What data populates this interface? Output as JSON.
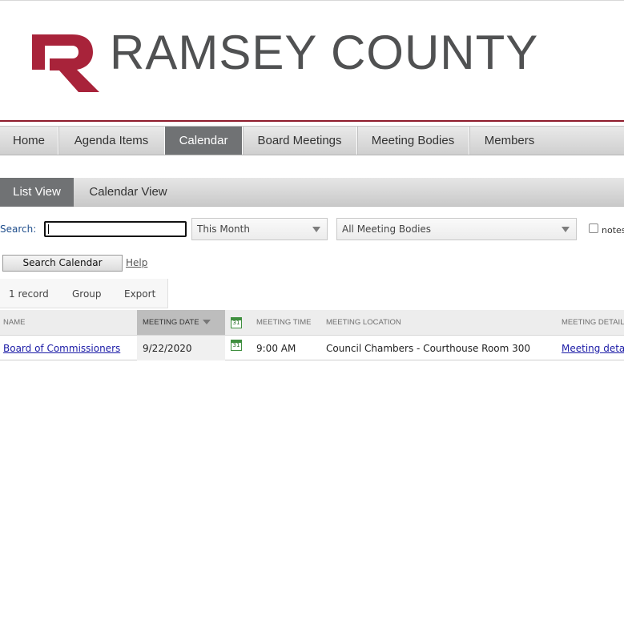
{
  "header": {
    "title": "RAMSEY COUNTY",
    "brand_color": "#a8233a"
  },
  "nav": {
    "items": [
      "Home",
      "Agenda Items",
      "Calendar",
      "Board Meetings",
      "Meeting Bodies",
      "Members"
    ],
    "active": "Calendar"
  },
  "subtabs": {
    "items": [
      "List View",
      "Calendar View"
    ],
    "active": "List View"
  },
  "search": {
    "label": "Search:",
    "value": "",
    "date_filter": "This Month",
    "body_filter": "All Meeting Bodies",
    "notes_label": "notes",
    "notes_checked": false,
    "button_label": "Search Calendar",
    "help_label": "Help"
  },
  "toolbar": {
    "record_count": "1 record",
    "group_label": "Group",
    "export_label": "Export"
  },
  "table": {
    "columns": [
      "NAME",
      "MEETING DATE",
      "MEETING TIME",
      "MEETING LOCATION",
      "MEETING DETAILS"
    ],
    "sorted_column": "MEETING DATE",
    "calendar_icon_text": "31",
    "rows": [
      {
        "name": "Board of Commissioners",
        "date": "9/22/2020",
        "time": "9:00 AM",
        "location": "Council Chambers - Courthouse Room 300",
        "details": "Meeting details"
      }
    ]
  }
}
